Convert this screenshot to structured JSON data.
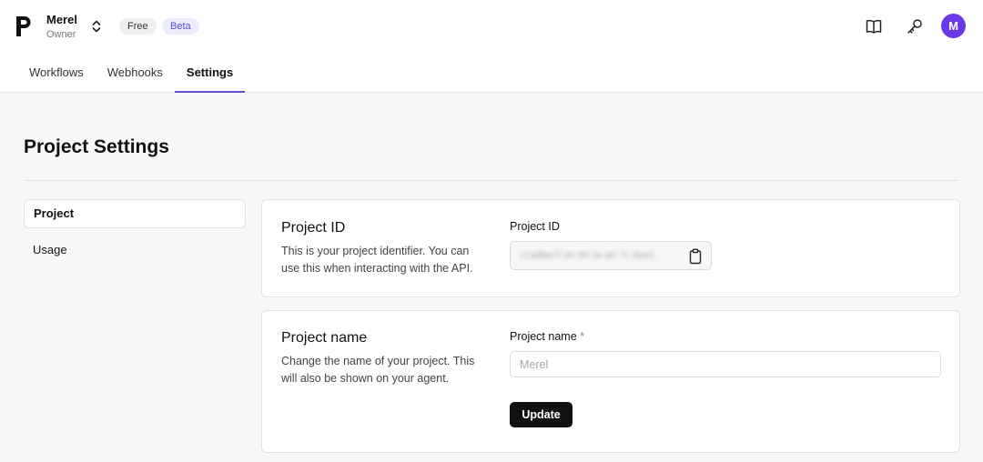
{
  "header": {
    "project_name": "Merel",
    "project_role": "Owner",
    "badges": [
      "Free",
      "Beta"
    ],
    "avatar_initial": "M",
    "colors": {
      "accent": "#5b50d6",
      "avatar": "#6a39e6"
    },
    "icons": [
      "logo-icon",
      "chevron-updown-icon",
      "book-icon",
      "key-icon"
    ]
  },
  "tabs": [
    {
      "label": "Workflows",
      "active": false
    },
    {
      "label": "Webhooks",
      "active": false
    },
    {
      "label": "Settings",
      "active": true
    }
  ],
  "page": {
    "title": "Project Settings"
  },
  "sidebar": {
    "items": [
      {
        "label": "Project",
        "active": true
      },
      {
        "label": "Usage",
        "active": false
      }
    ]
  },
  "project_id_card": {
    "title": "Project ID",
    "description": "This is your project identifier. You can use this when interacting with the API.",
    "field_label": "Project ID",
    "value": "c1a8be7f e0 86 0e b0 7c 8ecb",
    "copy_icon": "clipboard-icon"
  },
  "project_name_card": {
    "title": "Project name",
    "description": "Change the name of your project. This will also be shown on your agent.",
    "field_label": "Project name",
    "required_marker": "*",
    "placeholder": "Merel",
    "button_label": "Update"
  }
}
